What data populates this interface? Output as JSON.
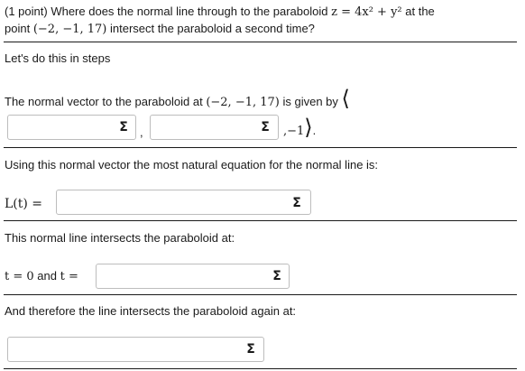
{
  "problem": {
    "points": "(1 point)",
    "question_part1": "Where does the normal line through to the paraboloid",
    "surface_eq": "z = 4x² + y²",
    "question_part2": "at the",
    "question_part3": "point",
    "point": "(−2, −1, 17)",
    "question_part4": "intersect the paraboloid a second time?"
  },
  "steps_intro": "Let's do this in steps",
  "step1": {
    "prefix": "The normal vector to the paraboloid at",
    "point": "(−2, −1, 17)",
    "suffix": "is given by",
    "open_bracket": "⟨",
    "comma": ",",
    "third_component": ",−1",
    "close_bracket": "⟩",
    "period": "."
  },
  "step2": {
    "text": "Using this normal vector the most natural equation for the normal line is:",
    "label": "L(t) ="
  },
  "step3": {
    "text": "This normal line intersects the paraboloid at:",
    "t_zero": "t = 0",
    "and": "and",
    "t_eq": "t ="
  },
  "step4": {
    "text": "And therefore the line intersects the paraboloid again at:"
  },
  "inputs": {
    "n1": "",
    "n2": "",
    "line": "",
    "t2": "",
    "point": ""
  },
  "icons": {
    "equation_editor": "sigma-icon",
    "equation_editor_glyph": "Σ"
  }
}
